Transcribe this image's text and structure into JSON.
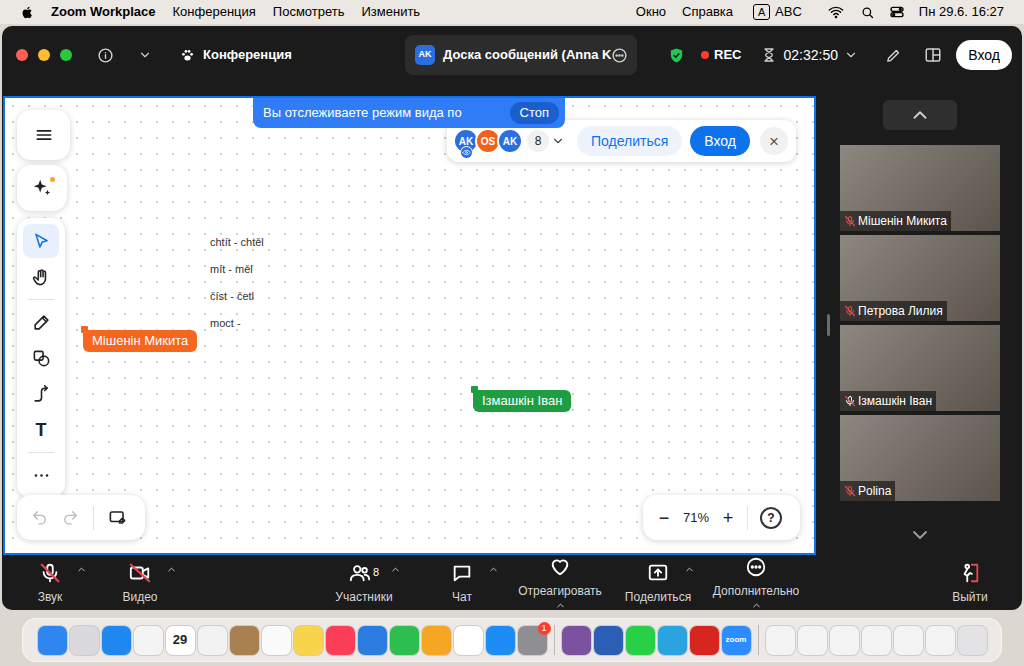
{
  "menubar": {
    "app_name": "Zoom Workplace",
    "menus": [
      "Конференция",
      "Посмотреть",
      "Изменить"
    ],
    "extras": [
      "Окно",
      "Справка"
    ],
    "input_source_badge": "A",
    "input_source": "ABC",
    "clock": "Пн 29.6. 16:27"
  },
  "window": {
    "title": "Конференция",
    "tab": {
      "badge": "AK",
      "label": "Доска сообщений (Anna K",
      "selected": true
    },
    "recording": {
      "label": "REC",
      "on": true
    },
    "timer": "02:32:50",
    "signin_button": "Вход"
  },
  "whiteboard": {
    "banner": {
      "text": "Вы отслеживаете режим вида по",
      "stop_button": "Стоп"
    },
    "collaborators": [
      {
        "initials": "AK",
        "color": "#2b6ee0",
        "followed": true
      },
      {
        "initials": "OS",
        "color": "#f0611c",
        "followed": false
      },
      {
        "initials": "AK",
        "color": "#2b6ee0",
        "followed": false
      }
    ],
    "collaborator_count": "8",
    "share_button": "Поделиться",
    "signin_button": "Вход",
    "close_button": "×",
    "tools": [
      {
        "kind": "select",
        "selected": true
      },
      {
        "kind": "hand",
        "selected": false
      },
      {
        "kind": "pen",
        "selected": false
      },
      {
        "kind": "shapes",
        "selected": false
      },
      {
        "kind": "connector",
        "selected": false
      },
      {
        "kind": "text",
        "label": "T",
        "selected": false
      },
      {
        "kind": "more",
        "selected": false
      }
    ],
    "undo": {
      "disabled": true
    },
    "redo": {
      "disabled": true
    },
    "notes": [
      "chtít - chtěl",
      "mít - měl",
      "číst - četl",
      "moct -"
    ],
    "cursors": [
      {
        "name": "Мішенін Микита",
        "color": "#f5661f"
      },
      {
        "name": "Ізмашкін Іван",
        "color": "#1e9e41"
      }
    ],
    "zoom": {
      "minus": "−",
      "level": "71%",
      "plus": "+",
      "help": "?"
    }
  },
  "participants": [
    {
      "name": "Мішенін Микита",
      "muted": true
    },
    {
      "name": "Петрова Лилия",
      "muted": true
    },
    {
      "name": "Ізмашкін Іван",
      "muted": false
    },
    {
      "name": "Polina",
      "muted": true
    }
  ],
  "toolbar": {
    "items": [
      {
        "kind": "audio",
        "label": "Звук",
        "off": true,
        "has_menu": true
      },
      {
        "kind": "video",
        "label": "Видео",
        "off": true,
        "has_menu": true
      },
      {
        "kind": "participants",
        "label": "Участники",
        "count": "8",
        "off": false,
        "has_menu": true
      },
      {
        "kind": "chat",
        "label": "Чат",
        "off": false,
        "has_menu": true
      },
      {
        "kind": "react",
        "label": "Отреагировать",
        "off": false,
        "has_menu": false
      },
      {
        "kind": "share",
        "label": "Поделиться",
        "off": false,
        "has_menu": true
      },
      {
        "kind": "more",
        "label": "Дополнительно",
        "off": false,
        "has_menu": false
      }
    ],
    "leave": "Выйти"
  },
  "dock": [
    {
      "kind": "app",
      "color": "#2f86f0"
    },
    {
      "kind": "app",
      "color": "#d9d9de"
    },
    {
      "kind": "app",
      "color": "#1e88f0"
    },
    {
      "kind": "app",
      "color": "#f4f4f4"
    },
    {
      "kind": "app",
      "color": "#ffffff",
      "label": "29"
    },
    {
      "kind": "app",
      "color": "#f2f2f2"
    },
    {
      "kind": "app",
      "color": "#a9804f"
    },
    {
      "kind": "app",
      "color": "#fafafa"
    },
    {
      "kind": "app",
      "color": "#f8d44c"
    },
    {
      "kind": "app",
      "color": "#fb3d58"
    },
    {
      "kind": "app",
      "color": "#2b7be0"
    },
    {
      "kind": "app",
      "color": "#2ebd4f"
    },
    {
      "kind": "app",
      "color": "#f5a623"
    },
    {
      "kind": "app",
      "color": "#ffffff"
    },
    {
      "kind": "app",
      "color": "#1d8df5"
    },
    {
      "kind": "app",
      "color": "#8e8e93",
      "badge": "1"
    },
    {
      "kind": "separator"
    },
    {
      "kind": "app",
      "color": "#7b51a0"
    },
    {
      "kind": "app",
      "color": "#2b5eb4"
    },
    {
      "kind": "app",
      "color": "#27d045"
    },
    {
      "kind": "app",
      "color": "#2aa3e0"
    },
    {
      "kind": "app",
      "color": "#d7261f"
    },
    {
      "kind": "app",
      "color": "#2d8cff",
      "label": "zoom"
    },
    {
      "kind": "separator"
    },
    {
      "kind": "app",
      "color": "#f3f3f3"
    },
    {
      "kind": "app",
      "color": "#f3f3f3"
    },
    {
      "kind": "app",
      "color": "#f3f3f3"
    },
    {
      "kind": "app",
      "color": "#f3f3f3"
    },
    {
      "kind": "app",
      "color": "#f3f3f3"
    },
    {
      "kind": "app",
      "color": "#f3f3f3"
    },
    {
      "kind": "app",
      "color": "#e3e3e6"
    }
  ]
}
